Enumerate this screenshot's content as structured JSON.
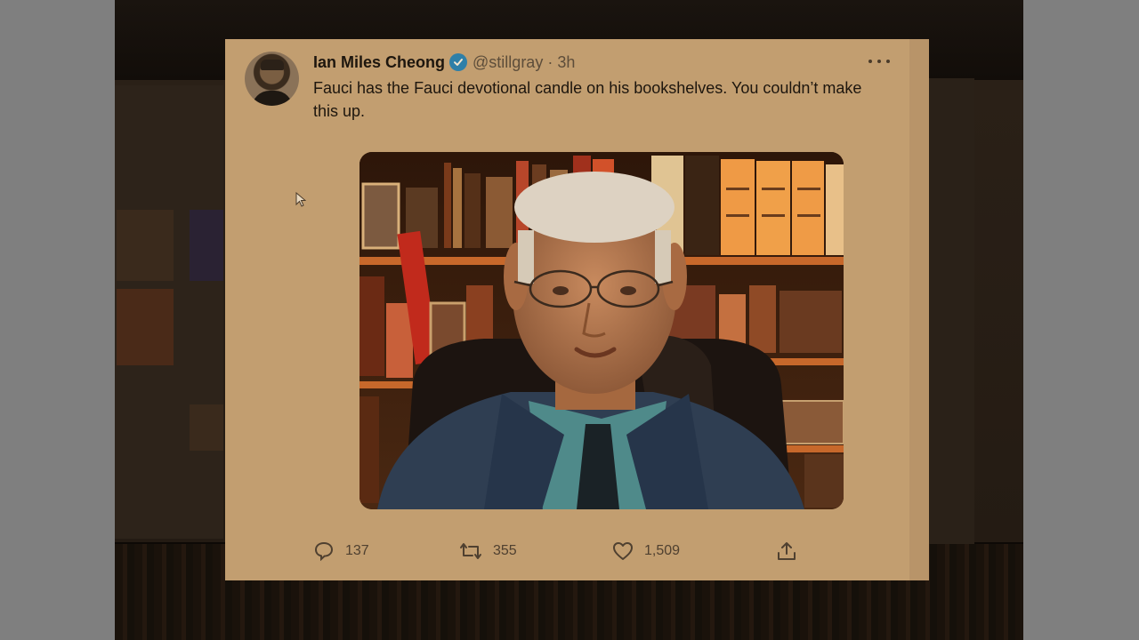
{
  "tweet": {
    "author_name": "Ian Miles Cheong",
    "handle": "@stillgray",
    "separator": "·",
    "time": "3h",
    "text": "Fauci has the Fauci devotional candle on his bookshelves. You couldn’t make this up.",
    "replies": "137",
    "retweets": "355",
    "likes": "1,509"
  },
  "colors": {
    "card": "#c29e70",
    "verified": "#2e7fa8",
    "text": "#1d160e"
  },
  "icons": {
    "more": "more-horizontal-icon",
    "reply": "reply-icon",
    "retweet": "retweet-icon",
    "like": "heart-icon",
    "share": "share-icon",
    "verified": "verified-badge-icon"
  }
}
